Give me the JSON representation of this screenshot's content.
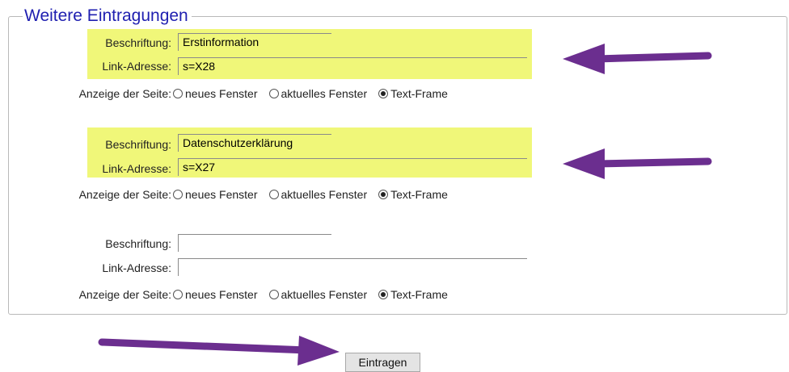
{
  "section": {
    "legend": "Weitere Eintragungen"
  },
  "labels": {
    "caption": "Beschriftung:",
    "link": "Link-Adresse:",
    "display": "Anzeige der Seite:"
  },
  "options": [
    "neues Fenster",
    "aktuelles Fenster",
    "Text-Frame"
  ],
  "entries": [
    {
      "caption_value": "Erstinformation",
      "link_value": "s=X28",
      "selected": "Text-Frame",
      "highlighted": true
    },
    {
      "caption_value": "Datenschutzerklärung",
      "link_value": "s=X27",
      "selected": "Text-Frame",
      "highlighted": true
    },
    {
      "caption_value": "",
      "link_value": "",
      "selected": "Text-Frame",
      "highlighted": false
    }
  ],
  "submit": {
    "label": "Eintragen"
  },
  "colors": {
    "highlight": "#f0f779",
    "legend": "#1f1fb0",
    "arrow": "#6b2e8f"
  }
}
